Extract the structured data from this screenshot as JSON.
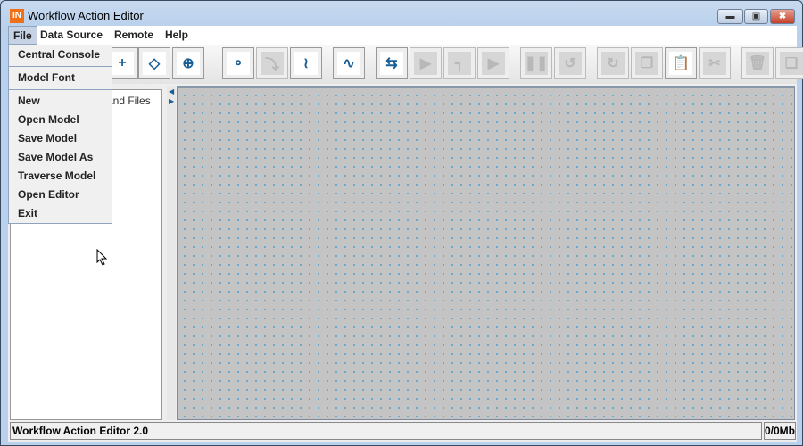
{
  "window": {
    "title": "Workflow Action Editor",
    "icon": "app-logo-icon",
    "app_icon_text": "IN",
    "controls": [
      "minimize",
      "maximize",
      "close"
    ]
  },
  "menubar": {
    "items": [
      "File",
      "Data Source",
      "Remote",
      "Help"
    ],
    "active": "File"
  },
  "file_menu": {
    "groups": [
      [
        "Central Console"
      ],
      [
        "Model Font"
      ],
      [
        "New",
        "Open Model",
        "Save Model",
        "Save Model As",
        "Traverse Model",
        "Open Editor",
        "Exit"
      ]
    ]
  },
  "toolbar": {
    "buttons": [
      {
        "icon": "add-node-icon",
        "enabled": true
      },
      {
        "icon": "add-decision-icon",
        "enabled": true
      },
      {
        "icon": "add-subprocess-icon",
        "enabled": true
      },
      {
        "icon": "add-branch-icon",
        "enabled": true
      },
      {
        "icon": "connect-icon",
        "enabled": false
      },
      {
        "icon": "connect-step-icon",
        "enabled": true
      },
      {
        "icon": "connect-curve-icon",
        "enabled": true
      },
      {
        "icon": "swap-icon",
        "enabled": true
      },
      {
        "icon": "debug-run-icon",
        "enabled": false
      },
      {
        "icon": "debug-step-icon",
        "enabled": false
      },
      {
        "icon": "play-icon",
        "enabled": false
      },
      {
        "icon": "pause-icon",
        "enabled": false
      },
      {
        "icon": "undo-icon",
        "enabled": false
      },
      {
        "icon": "redo-icon",
        "enabled": false
      },
      {
        "icon": "copy-icon",
        "enabled": false
      },
      {
        "icon": "paste-icon",
        "enabled": true
      },
      {
        "icon": "cut-icon",
        "enabled": false
      },
      {
        "icon": "delete-icon",
        "enabled": false
      },
      {
        "icon": "group-icon",
        "enabled": false
      },
      {
        "icon": "ungroup-icon",
        "enabled": false
      }
    ]
  },
  "left_panel": {
    "tab_label_visible": "and Files"
  },
  "status": {
    "text": "Workflow Action Editor 2.0",
    "memory": "0/0Mb"
  },
  "colors": {
    "accent": "#1a5e96",
    "canvas": "#c4c4c4",
    "grid_dot": "#4a9fd6",
    "app_icon": "#f07018"
  }
}
